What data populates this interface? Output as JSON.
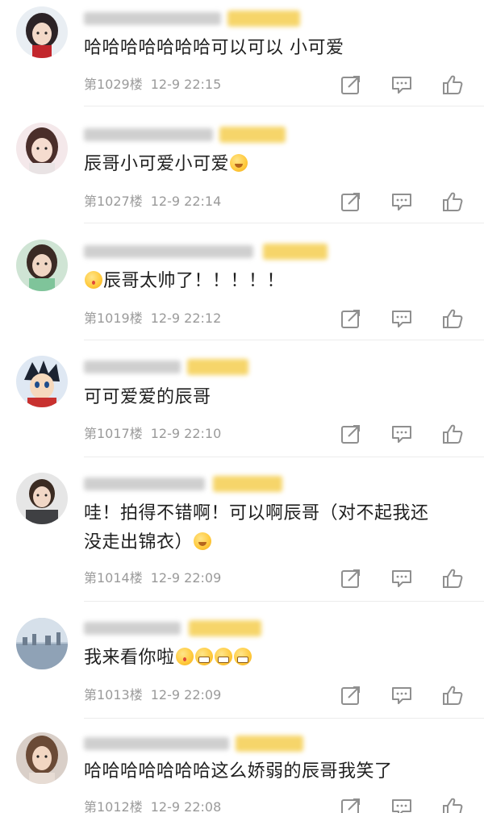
{
  "comments": [
    {
      "avatar_icon": "girl-illustration-avatar",
      "text": "哈哈哈哈哈哈哈可以可以 小可爱",
      "floor": "第1029楼",
      "time": "12-9 22:15"
    },
    {
      "avatar_icon": "girl-cat-filter-avatar",
      "text": "辰哥小可爱小可爱",
      "emoji": "smile-emoji",
      "floor": "第1027楼",
      "time": "12-9 22:14"
    },
    {
      "avatar_icon": "girl-photo-avatar",
      "text": "辰哥太帅了！！！！！",
      "emoji_before": "yummy-emoji",
      "floor": "第1019楼",
      "time": "12-9 22:12"
    },
    {
      "avatar_icon": "cartoon-boy-avatar",
      "text": "可可爱爱的辰哥",
      "floor": "第1017楼",
      "time": "12-9 22:10"
    },
    {
      "avatar_icon": "woman-photo-avatar",
      "text_line1": "哇！拍得不错啊！可以啊辰哥（对不起我还",
      "text_line2": "没走出锦衣）",
      "emoji": "laugh-cry-emoji",
      "floor": "第1014楼",
      "time": "12-9 22:09"
    },
    {
      "avatar_icon": "city-landscape-avatar",
      "text": "我来看你啦",
      "emoji": "tongue-grin-emoji",
      "floor": "第1013楼",
      "time": "12-9 22:09"
    },
    {
      "avatar_icon": "woman-portrait-avatar",
      "text": "哈哈哈哈哈哈哈这么娇弱的辰哥我笑了",
      "floor": "第1012楼",
      "time": "12-9 22:08"
    }
  ],
  "actions": {
    "forward_icon": "share-arrow-icon",
    "reply_icon": "comment-bubble-icon",
    "like_icon": "thumbs-up-icon"
  },
  "colors": {
    "meta_gray": "#9a9a9a",
    "icon_gray": "#8f8f8f",
    "blur_highlight": "#f6d56a"
  }
}
